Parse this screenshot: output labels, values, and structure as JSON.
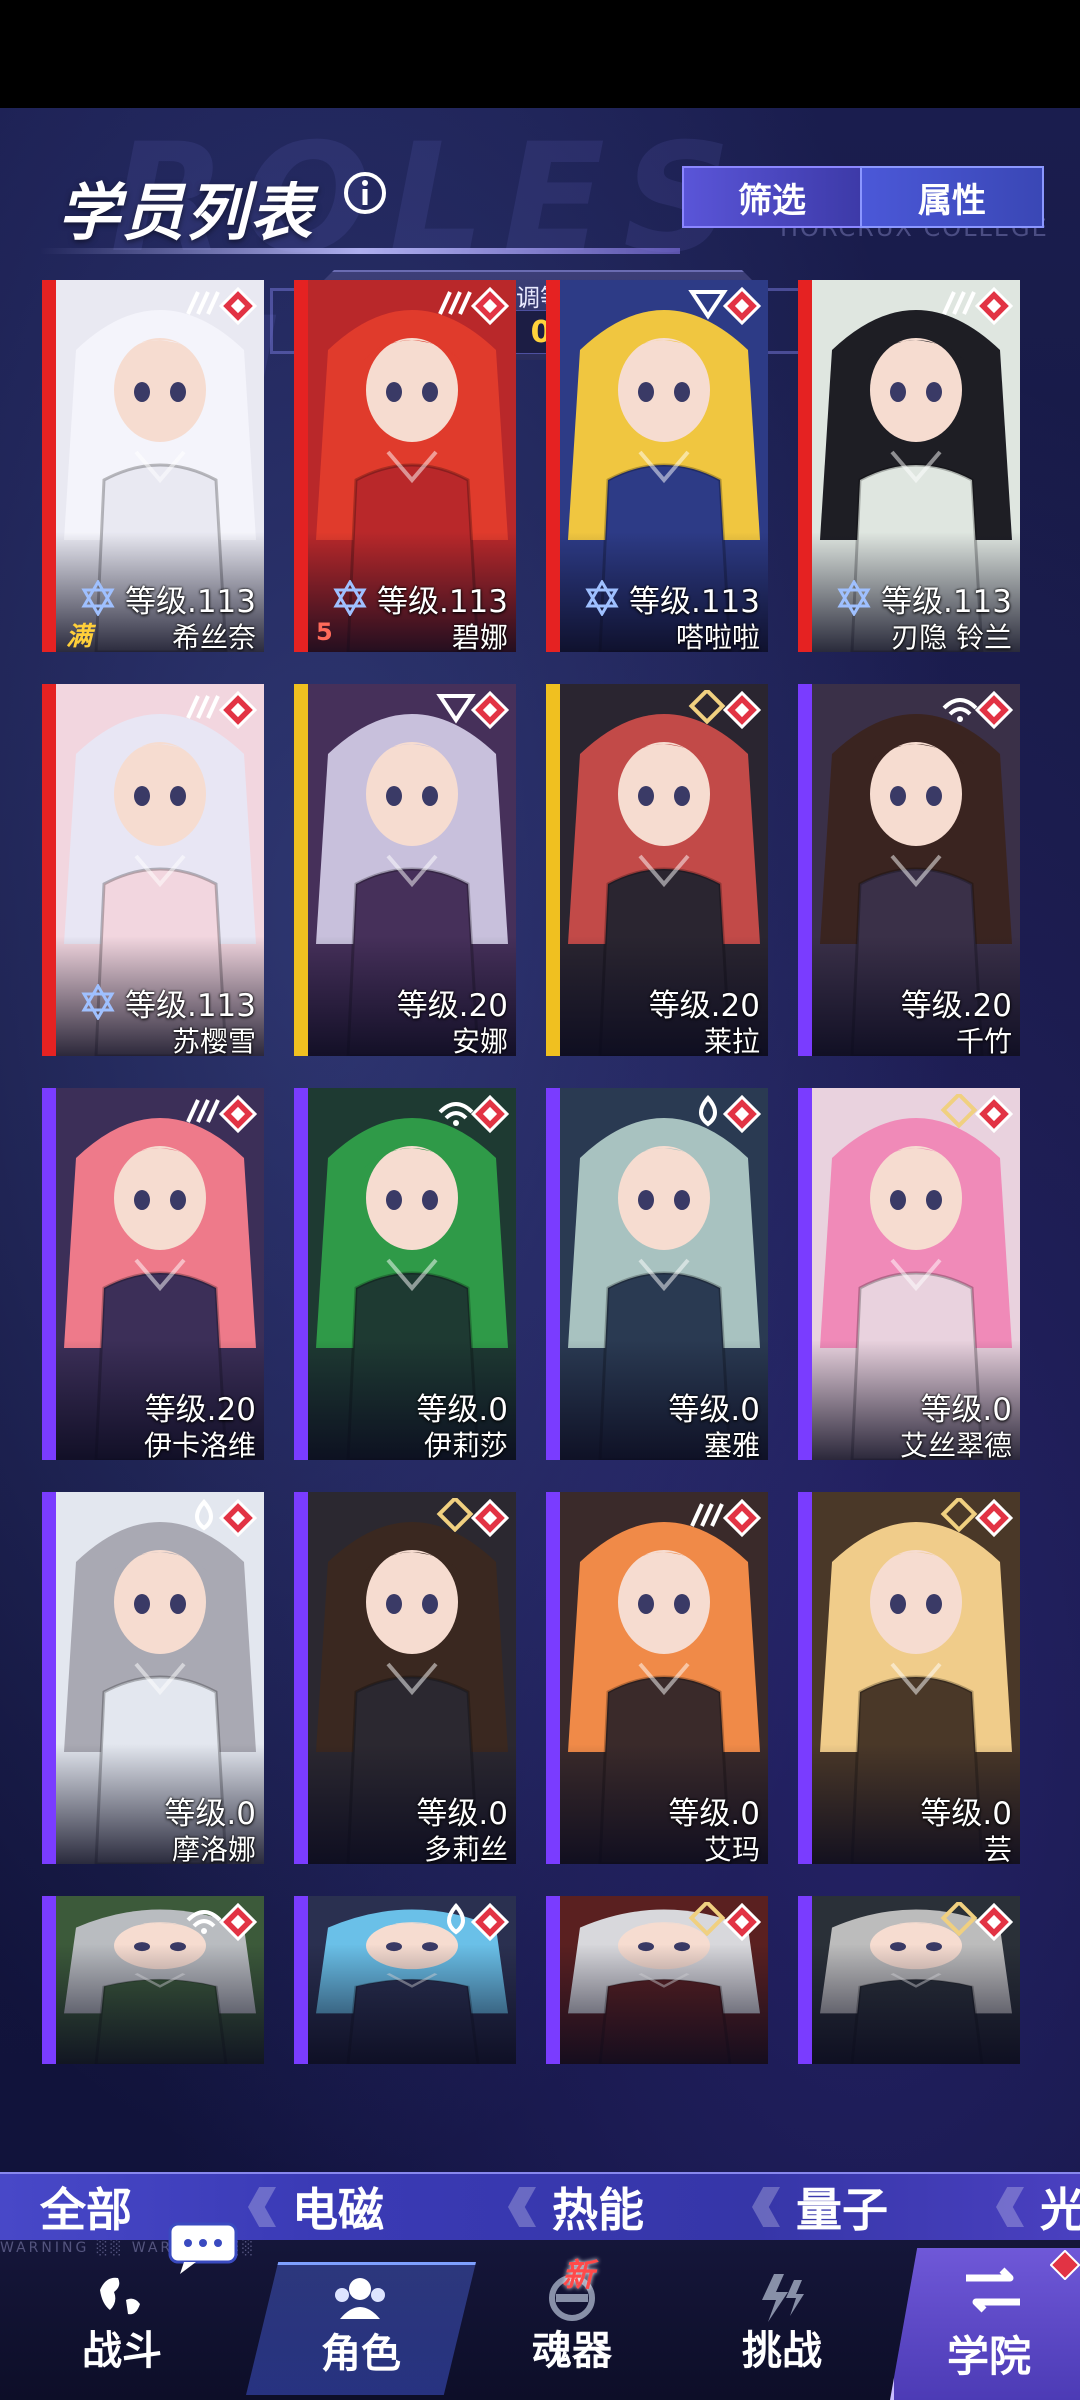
{
  "header": {
    "title": "学员列表",
    "filter_label": "筛选",
    "attribute_label": "属性",
    "coord_label": "协调等级",
    "coord_value": "0"
  },
  "students": [
    {
      "level": "等级.113",
      "name": "希丝奈",
      "stripe": "#e52222",
      "tone": "#e9e9f2",
      "hair": "#f4f4fb",
      "star": true,
      "tag": "满"
    },
    {
      "level": "等级.113",
      "name": "碧娜",
      "stripe": "#e52222",
      "tone": "#b9282a",
      "hair": "#e03b2c",
      "star": true,
      "tag": "5"
    },
    {
      "level": "等级.113",
      "name": "嗒啦啦",
      "stripe": "#e52222",
      "tone": "#2d3b86",
      "hair": "#f0c640",
      "star": true
    },
    {
      "level": "等级.113",
      "name": "刃隐 铃兰",
      "stripe": "#e52222",
      "tone": "#dfe6e0",
      "hair": "#1e1e24",
      "star": true
    },
    {
      "level": "等级.113",
      "name": "苏樱雪",
      "stripe": "#e52222",
      "tone": "#f2d6df",
      "hair": "#e8e6f4",
      "star": true
    },
    {
      "level": "等级.20",
      "name": "安娜",
      "stripe": "#f0c020",
      "tone": "#46305a",
      "hair": "#c8c0dc"
    },
    {
      "level": "等级.20",
      "name": "莱拉",
      "stripe": "#f0c020",
      "tone": "#2a2530",
      "hair": "#c24a48"
    },
    {
      "level": "等级.20",
      "name": "千竹",
      "stripe": "#7a3cff",
      "tone": "#3a3048",
      "hair": "#3a2420"
    },
    {
      "level": "等级.20",
      "name": "伊卡洛维",
      "stripe": "#7a3cff",
      "tone": "#3c2f58",
      "hair": "#ee7a8a"
    },
    {
      "level": "等级.0",
      "name": "伊莉莎",
      "stripe": "#7a3cff",
      "tone": "#1e3a32",
      "hair": "#2f9a48"
    },
    {
      "level": "等级.0",
      "name": "塞雅",
      "stripe": "#7a3cff",
      "tone": "#2a3a52",
      "hair": "#a8c2c0"
    },
    {
      "level": "等级.0",
      "name": "艾丝翠德",
      "stripe": "#7a3cff",
      "tone": "#e9d2de",
      "hair": "#f08ab8"
    },
    {
      "level": "等级.0",
      "name": "摩洛娜",
      "stripe": "#7a3cff",
      "tone": "#e3e7ef",
      "hair": "#a9a9b3"
    },
    {
      "level": "等级.0",
      "name": "多莉丝",
      "stripe": "#7a3cff",
      "tone": "#2b2830",
      "hair": "#3a2820"
    },
    {
      "level": "等级.0",
      "name": "艾玛",
      "stripe": "#7a3cff",
      "tone": "#3a2a2a",
      "hair": "#f08a48"
    },
    {
      "level": "等级.0",
      "name": "芸",
      "stripe": "#7a3cff",
      "tone": "#4a3828",
      "hair": "#f0cc8a"
    },
    {
      "level": "",
      "name": "",
      "stripe": "#7a3cff",
      "tone": "#3c5a3a",
      "hair": "#b9bcc0"
    },
    {
      "level": "",
      "name": "",
      "stripe": "#7a3cff",
      "tone": "#2a3050",
      "hair": "#6ac0e8"
    },
    {
      "level": "",
      "name": "",
      "stripe": "#7a3cff",
      "tone": "#5a2020",
      "hair": "#d8d8dc"
    },
    {
      "level": "",
      "name": "",
      "stripe": "#7a3cff",
      "tone": "#2a3038",
      "hair": "#bcbcbc"
    }
  ],
  "element_tabs": [
    "全部",
    "电磁",
    "热能",
    "量子",
    "光"
  ],
  "nav": {
    "items": [
      "战斗",
      "角色",
      "魂器",
      "挑战",
      "学院"
    ],
    "new_badge": "新",
    "warning_text": "WARNING"
  }
}
